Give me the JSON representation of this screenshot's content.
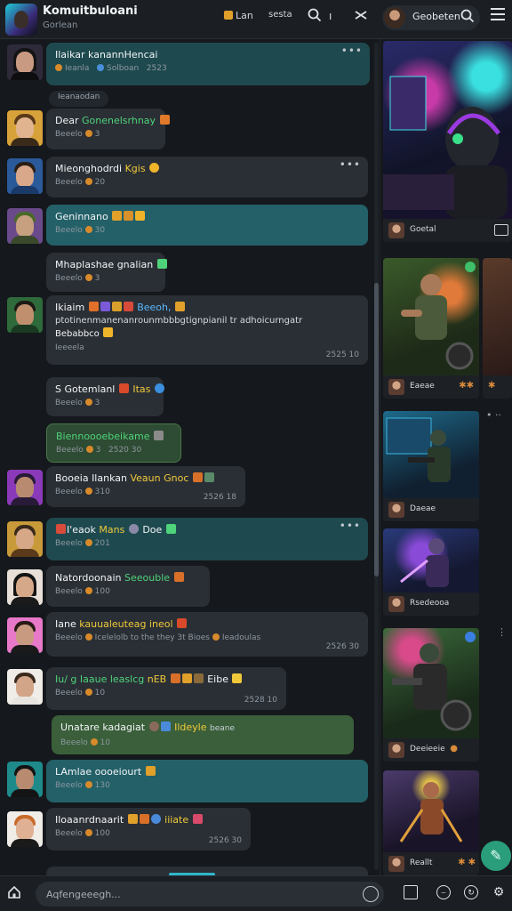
{
  "header": {
    "title": "Komuitbuloani",
    "subtitle": "Gorlean",
    "item1": "Lan",
    "item2": "sesta",
    "search_glyph": "Q",
    "profile_name": "Geobeten"
  },
  "messages": [
    {
      "text": "Ilaikar kanannHencai",
      "meta": "Ieanla",
      "meta2": "Solboan",
      "time": "2523"
    },
    {
      "text": "Dear",
      "accent": "Gonenelsrhnay",
      "meta": "Beeelo",
      "meta2": "3"
    },
    {
      "text": "Mieonghodrdi",
      "accent": "Kgis",
      "meta": "Beeelo",
      "meta2": "20"
    },
    {
      "text": "Geninnano",
      "meta": "Beeelo",
      "meta2": "30"
    },
    {
      "text": "Mhaplashae gnalian",
      "meta": "Beeelo",
      "meta2": "3"
    },
    {
      "text": "Ikiaim",
      "accent": "Beeoh,",
      "line2": "ptotinenmanenanrounmbbbgtignpianil tr adhoicurngatr",
      "line3": "Bebabbco",
      "meta": "Ieeeela",
      "time": "2525 10"
    },
    {
      "text": "S Gotemlanl",
      "accent": "Itas",
      "meta": "Beeelo",
      "meta2": "3"
    },
    {
      "text": "Biennoooebeikame",
      "meta": "Beeelo",
      "meta2": "3",
      "time": "2520 30"
    },
    {
      "text": "Booeia Ilankan",
      "accent": "Veaun Gnoc",
      "meta": "Beeelo",
      "meta2": "310",
      "time": "2526 18"
    },
    {
      "text": "I'eaok",
      "accent": "Mans",
      "extra": "Doe",
      "meta": "Beeelo",
      "meta2": "201"
    },
    {
      "text": "Natordoonain",
      "accent": "Seeouble",
      "meta": "Beeelo",
      "meta2": "100"
    },
    {
      "text": "Iane",
      "accent": "kauualeuteag ineol",
      "line2": "Icelelolb to the they 3t Bioes",
      "meta": "Beeelo",
      "meta2": "Ieadoulas",
      "time": "2526 30"
    },
    {
      "text": "Iu/ g Iaaue leaslcg",
      "accent": "nEB",
      "extra": "Eibe",
      "meta": "Beeelo",
      "meta2": "10",
      "time": "2528 10"
    },
    {
      "text": "Unatare kadagiat",
      "accent": "Ildeyle",
      "extra": "beane",
      "meta": "Beeelo",
      "meta2": "10"
    },
    {
      "text": "LAmlae oooeiourt",
      "meta": "Beeelo",
      "meta2": "130"
    },
    {
      "text": "Iloaanrdnaarit",
      "accent": "iiiate",
      "meta": "Beeelo",
      "meta2": "100",
      "time": "2526 30"
    }
  ],
  "system_pill": "Ieanaodan",
  "side_cards": [
    {
      "label": "Goetal"
    },
    {
      "label": "Eaeae"
    },
    {
      "label": "Daeae"
    },
    {
      "label": "Rsedeooa"
    },
    {
      "label": "Deeieeie"
    },
    {
      "label": "Reallt"
    }
  ],
  "composer": {
    "placeholder": "Aqfengeeegh..."
  }
}
